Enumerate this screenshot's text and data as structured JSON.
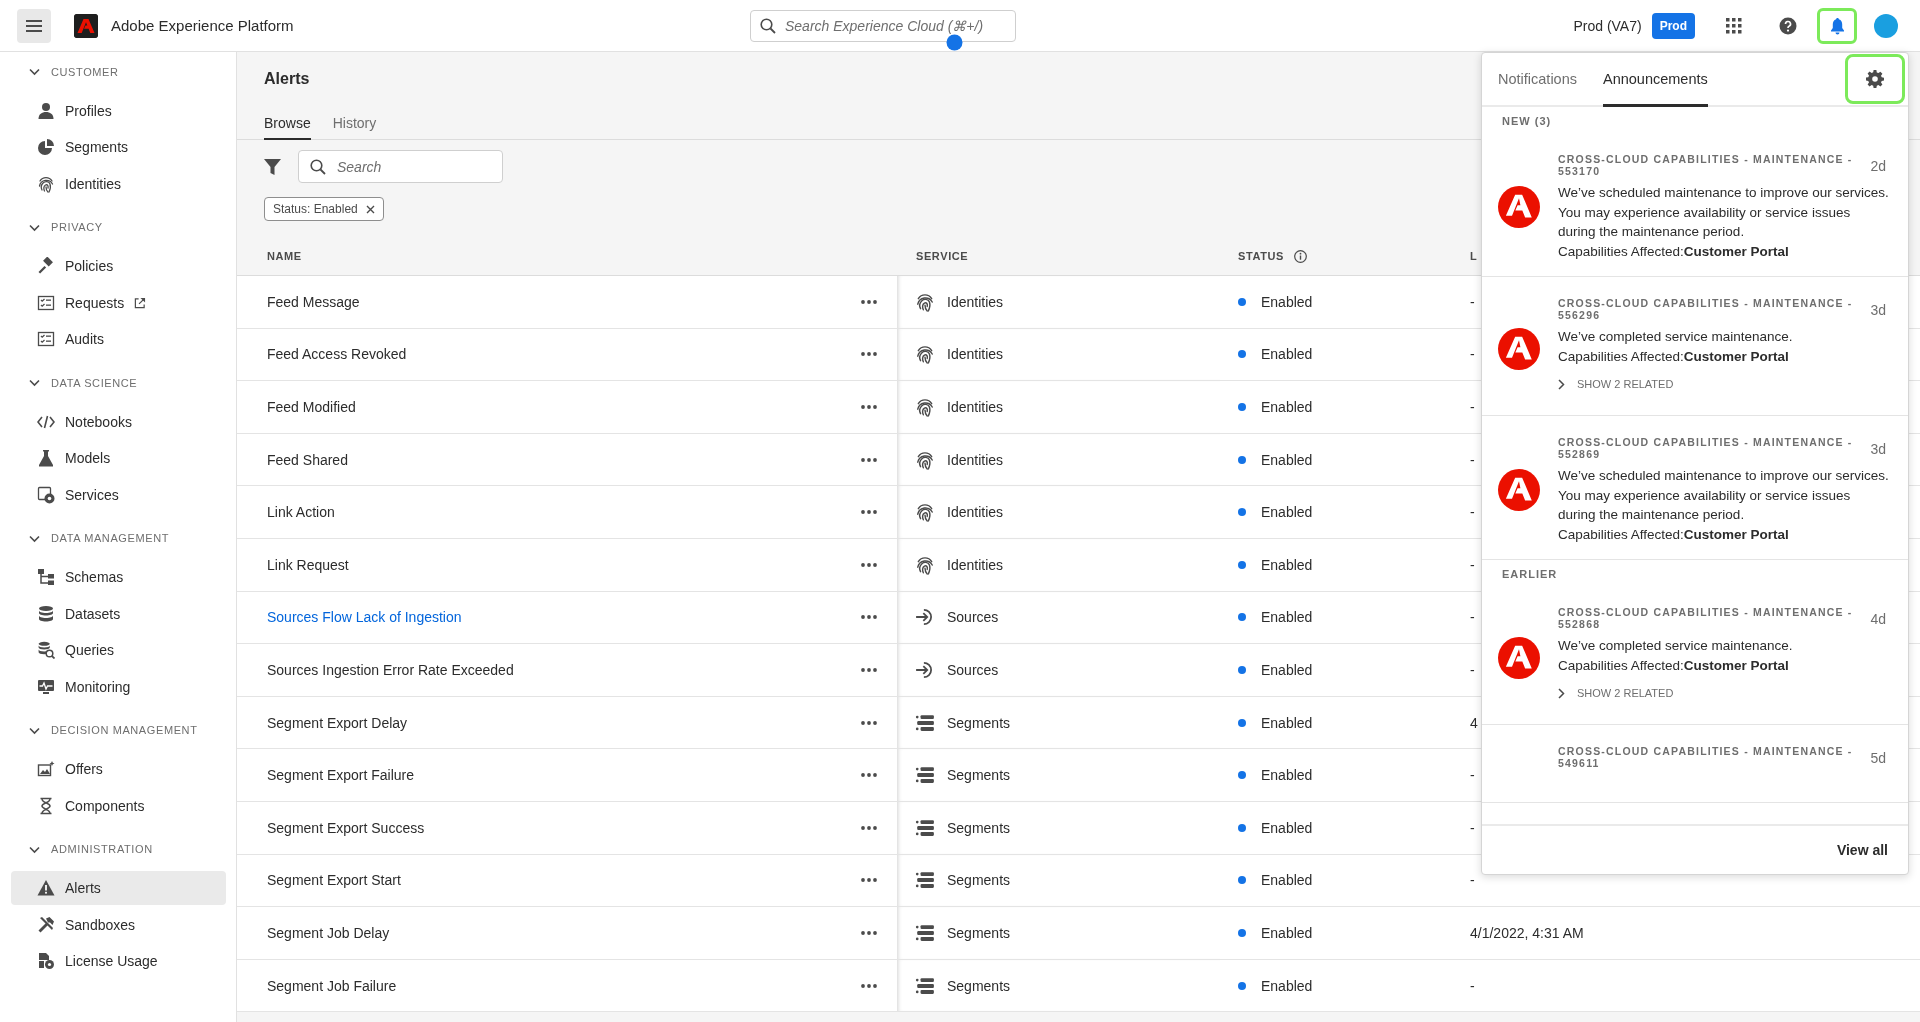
{
  "topbar": {
    "app_name": "Adobe Experience Platform",
    "search": {
      "placeholder": "Search Experience Cloud (⌘+/)"
    },
    "org": "Prod (VA7)",
    "sandbox_badge": "Prod",
    "bell_highlighted": true
  },
  "sidebar": {
    "sections": [
      {
        "heading": "CUSTOMER",
        "expanded": true,
        "items": [
          {
            "label": "Profiles",
            "selected": false,
            "external": false
          },
          {
            "label": "Segments",
            "selected": false,
            "external": false
          },
          {
            "label": "Identities",
            "selected": false,
            "external": false
          }
        ]
      },
      {
        "heading": "PRIVACY",
        "expanded": true,
        "items": [
          {
            "label": "Policies",
            "selected": false,
            "external": false
          },
          {
            "label": "Requests",
            "selected": false,
            "external": true
          },
          {
            "label": "Audits",
            "selected": false,
            "external": false
          }
        ]
      },
      {
        "heading": "DATA SCIENCE",
        "expanded": true,
        "items": [
          {
            "label": "Notebooks",
            "selected": false,
            "external": false
          },
          {
            "label": "Models",
            "selected": false,
            "external": false
          },
          {
            "label": "Services",
            "selected": false,
            "external": false
          }
        ]
      },
      {
        "heading": "DATA MANAGEMENT",
        "expanded": true,
        "items": [
          {
            "label": "Schemas",
            "selected": false,
            "external": false
          },
          {
            "label": "Datasets",
            "selected": false,
            "external": false
          },
          {
            "label": "Queries",
            "selected": false,
            "external": false
          },
          {
            "label": "Monitoring",
            "selected": false,
            "external": false
          }
        ]
      },
      {
        "heading": "DECISION MANAGEMENT",
        "expanded": true,
        "items": [
          {
            "label": "Offers",
            "selected": false,
            "external": false
          },
          {
            "label": "Components",
            "selected": false,
            "external": false
          }
        ]
      },
      {
        "heading": "ADMINISTRATION",
        "expanded": true,
        "items": [
          {
            "label": "Alerts",
            "selected": true,
            "external": false
          },
          {
            "label": "Sandboxes",
            "selected": false,
            "external": false
          },
          {
            "label": "License Usage",
            "selected": false,
            "external": false
          }
        ]
      }
    ]
  },
  "page": {
    "title": "Alerts",
    "tabs": [
      {
        "label": "Browse",
        "selected": true
      },
      {
        "label": "History",
        "selected": false
      }
    ],
    "search": {
      "placeholder": "Search"
    },
    "filters": [
      {
        "label": "Status: Enabled"
      }
    ]
  },
  "table": {
    "columns": [
      "NAME",
      "SERVICE",
      "STATUS",
      "L"
    ],
    "rows": [
      {
        "name": "Feed Message",
        "hovered": false,
        "kind": "identities",
        "service": "Identities",
        "status": "Enabled",
        "enabled": true,
        "column_4": "-"
      },
      {
        "name": "Feed Access Revoked",
        "hovered": false,
        "kind": "identities",
        "service": "Identities",
        "status": "Enabled",
        "enabled": true,
        "column_4": "-"
      },
      {
        "name": "Feed Modified",
        "hovered": false,
        "kind": "identities",
        "service": "Identities",
        "status": "Enabled",
        "enabled": true,
        "column_4": "-"
      },
      {
        "name": "Feed Shared",
        "hovered": false,
        "kind": "identities",
        "service": "Identities",
        "status": "Enabled",
        "enabled": true,
        "column_4": "-"
      },
      {
        "name": "Link Action",
        "hovered": false,
        "kind": "identities",
        "service": "Identities",
        "status": "Enabled",
        "enabled": true,
        "column_4": "-"
      },
      {
        "name": "Link Request",
        "hovered": false,
        "kind": "identities",
        "service": "Identities",
        "status": "Enabled",
        "enabled": true,
        "column_4": "-"
      },
      {
        "name": "Sources Flow Lack of Ingestion",
        "hovered": true,
        "kind": "sources",
        "service": "Sources",
        "status": "Enabled",
        "enabled": true,
        "column_4": "-"
      },
      {
        "name": "Sources Ingestion Error Rate Exceeded",
        "hovered": false,
        "kind": "sources",
        "service": "Sources",
        "status": "Enabled",
        "enabled": true,
        "column_4": "-"
      },
      {
        "name": "Segment Export Delay",
        "hovered": false,
        "kind": "segments",
        "service": "Segments",
        "status": "Enabled",
        "enabled": true,
        "column_4": "4"
      },
      {
        "name": "Segment Export Failure",
        "hovered": false,
        "kind": "segments",
        "service": "Segments",
        "status": "Enabled",
        "enabled": true,
        "column_4": "-"
      },
      {
        "name": "Segment Export Success",
        "hovered": false,
        "kind": "segments",
        "service": "Segments",
        "status": "Enabled",
        "enabled": true,
        "column_4": "-"
      },
      {
        "name": "Segment Export Start",
        "hovered": false,
        "kind": "segments",
        "service": "Segments",
        "status": "Enabled",
        "enabled": true,
        "column_4": "-"
      },
      {
        "name": "Segment Job Delay",
        "hovered": false,
        "kind": "segments",
        "service": "Segments",
        "status": "Enabled",
        "enabled": true,
        "column_4": "4/1/2022, 4:31 AM"
      },
      {
        "name": "Segment Job Failure",
        "hovered": false,
        "kind": "segments",
        "service": "Segments",
        "status": "Enabled",
        "enabled": true,
        "column_4": "-"
      }
    ]
  },
  "panel": {
    "tabs": [
      {
        "label": "Notifications",
        "selected": false
      },
      {
        "label": "Announcements",
        "selected": true
      }
    ],
    "settings_highlighted": true,
    "groups": [
      {
        "heading": "NEW (3)",
        "items": [
          {
            "title": "CROSS-CLOUD CAPABILITIES - MAINTENANCE - 553170",
            "age": "2d",
            "body": "We’ve scheduled maintenance to improve our services. You may experience availability or service issues during the maintenance period.",
            "affected": "Capabilities Affected:**Customer Portal**"
          },
          {
            "title": "CROSS-CLOUD CAPABILITIES - MAINTENANCE - 556296",
            "age": "3d",
            "body": "We’ve completed service maintenance.",
            "affected": "Capabilities Affected:**Customer Portal**",
            "related": "SHOW 2 RELATED"
          },
          {
            "title": "CROSS-CLOUD CAPABILITIES - MAINTENANCE - 552869",
            "age": "3d",
            "body": "We’ve scheduled maintenance to improve our services. You may experience availability or service issues during the maintenance period.",
            "affected": "Capabilities Affected:**Customer Portal**"
          }
        ]
      },
      {
        "heading": "EARLIER",
        "items": [
          {
            "title": "CROSS-CLOUD CAPABILITIES - MAINTENANCE - 552868",
            "age": "4d",
            "body": "We’ve completed service maintenance.",
            "affected": "Capabilities Affected:**Customer Portal**",
            "related": "SHOW 2 RELATED"
          },
          {
            "title": "CROSS-CLOUD CAPABILITIES - MAINTENANCE - 549611",
            "age": "5d"
          }
        ]
      }
    ],
    "footer_link": "View all"
  }
}
